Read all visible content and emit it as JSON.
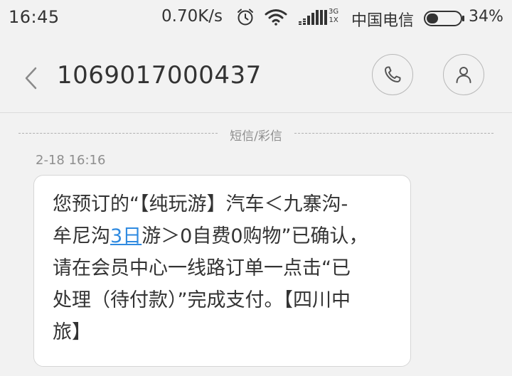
{
  "status_bar": {
    "time": "16:45",
    "net_speed": "0.70K/s",
    "network_type_top": "3G",
    "network_type_bottom": "1X",
    "carrier": "中国电信",
    "battery": "34%",
    "battery_level": 0.34
  },
  "header": {
    "title": "1069017000437",
    "icons": [
      "back-arrow-icon",
      "phone-icon",
      "person-icon"
    ]
  },
  "thread": {
    "section_label": "短信/彩信",
    "message": {
      "time": "2-18 16:16",
      "lines": [
        {
          "text": "您预订的“【纯玩游】汽车＜九寨沟-"
        },
        {
          "before": "牟尼沟",
          "link": "3日",
          "after": "游＞0自费0购物”已确认，"
        },
        {
          "text": "请在会员中心一线路订单一点击“已"
        },
        {
          "text": "处理（待付款）”完成支付。【四川中"
        },
        {
          "text": "旅】"
        }
      ]
    }
  },
  "colors": {
    "background": "#f2f2f2",
    "bubble": "#ffffff",
    "link": "#2f8ae0",
    "text": "#333333",
    "muted": "#8e8e8e"
  }
}
